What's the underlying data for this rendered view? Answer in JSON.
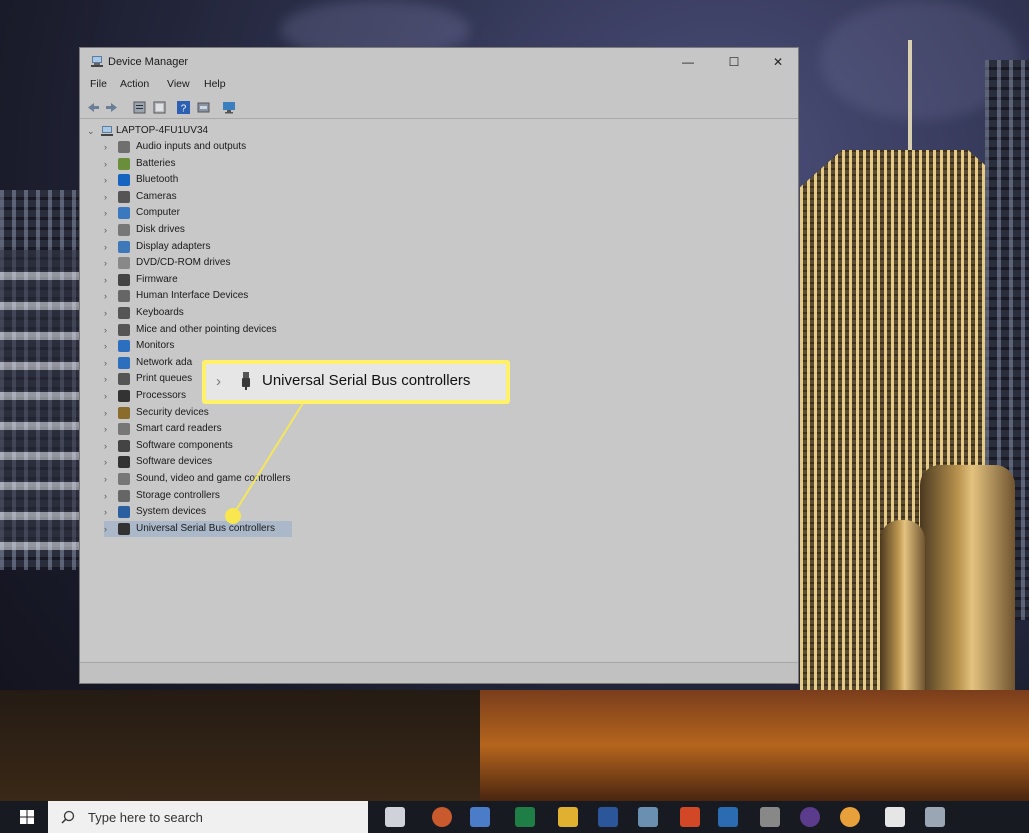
{
  "window": {
    "title": "Device Manager",
    "controls": {
      "minimize": "—",
      "maximize": "☐",
      "close": "✕"
    }
  },
  "menu": [
    "File",
    "Action",
    "View",
    "Help"
  ],
  "toolbar_icons": [
    "back-arrow-icon",
    "forward-arrow-icon",
    "properties-icon",
    "show-hidden-icon",
    "help-icon",
    "update-driver-icon",
    "scan-hardware-icon"
  ],
  "tree": {
    "root": "LAPTOP-4FU1UV34",
    "items": [
      {
        "label": "Audio inputs and outputs",
        "icon": "speaker-icon"
      },
      {
        "label": "Batteries",
        "icon": "battery-icon"
      },
      {
        "label": "Bluetooth",
        "icon": "bluetooth-icon"
      },
      {
        "label": "Cameras",
        "icon": "camera-icon"
      },
      {
        "label": "Computer",
        "icon": "computer-icon"
      },
      {
        "label": "Disk drives",
        "icon": "disk-drive-icon"
      },
      {
        "label": "Display adapters",
        "icon": "display-adapter-icon"
      },
      {
        "label": "DVD/CD-ROM drives",
        "icon": "dvd-icon"
      },
      {
        "label": "Firmware",
        "icon": "firmware-icon"
      },
      {
        "label": "Human Interface Devices",
        "icon": "hid-icon"
      },
      {
        "label": "Keyboards",
        "icon": "keyboard-icon"
      },
      {
        "label": "Mice and other pointing devices",
        "icon": "mouse-icon"
      },
      {
        "label": "Monitors",
        "icon": "monitor-icon"
      },
      {
        "label": "Network ada",
        "icon": "network-icon"
      },
      {
        "label": "Print queues",
        "icon": "printer-icon"
      },
      {
        "label": "Processors",
        "icon": "processor-icon"
      },
      {
        "label": "Security devices",
        "icon": "security-icon"
      },
      {
        "label": "Smart card readers",
        "icon": "smart-card-icon"
      },
      {
        "label": "Software components",
        "icon": "software-component-icon"
      },
      {
        "label": "Software devices",
        "icon": "software-device-icon"
      },
      {
        "label": "Sound, video and game controllers",
        "icon": "sound-icon"
      },
      {
        "label": "Storage controllers",
        "icon": "storage-icon"
      },
      {
        "label": "System devices",
        "icon": "system-icon"
      },
      {
        "label": "Universal Serial Bus controllers",
        "icon": "usb-icon"
      }
    ],
    "selected_index": 23
  },
  "callout": {
    "label": "Universal Serial Bus controllers",
    "accent": "#fff26a"
  },
  "taskbar": {
    "search_placeholder": "Type here to search",
    "apps": [
      "task-view-icon",
      "snagit-icon",
      "paint-icon",
      "excel-icon",
      "file-explorer-icon",
      "word-icon",
      "app-icon",
      "acrobat-icon",
      "photoshop-icon",
      "pen-icon",
      "slack-icon",
      "chrome-icon",
      "settings-icon",
      "network-app-icon"
    ]
  }
}
